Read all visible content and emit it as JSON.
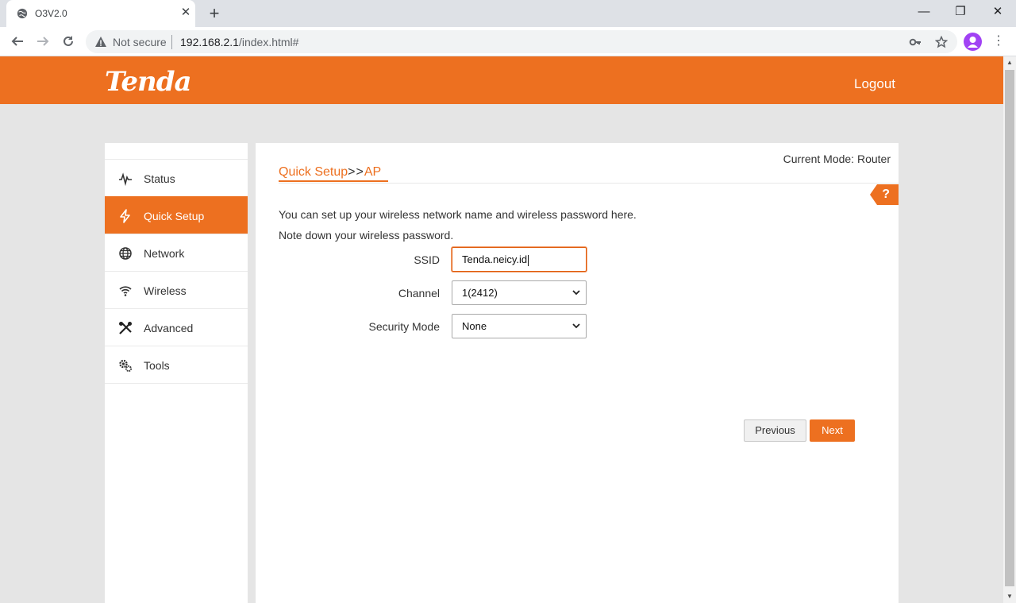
{
  "browser": {
    "tab_title": "O3V2.0",
    "tab_close": "✕",
    "new_tab": "+",
    "security_label": "Not secure",
    "url_host": "192.168.2.1",
    "url_path": "/index.html#",
    "window": {
      "minimize": "—",
      "restore": "❐",
      "close": "✕"
    }
  },
  "header": {
    "logo_text": "Tenda",
    "logout_label": "Logout"
  },
  "sidebar": {
    "items": [
      {
        "label": "Status",
        "icon": "pulse-icon"
      },
      {
        "label": "Quick Setup",
        "icon": "bolt-icon",
        "active": true
      },
      {
        "label": "Network",
        "icon": "globe-icon"
      },
      {
        "label": "Wireless",
        "icon": "wifi-icon"
      },
      {
        "label": "Advanced",
        "icon": "tools-icon"
      },
      {
        "label": "Tools",
        "icon": "gear-icon"
      }
    ]
  },
  "main": {
    "current_mode": "Current Mode: Router",
    "breadcrumb_section": "Quick Setup",
    "breadcrumb_sep": ">>",
    "breadcrumb_page": "AP",
    "help_label": "?",
    "description_1": "You can set up your wireless network name and wireless password here.",
    "description_2": "Note down your wireless password.",
    "form": {
      "ssid_label": "SSID",
      "ssid_value": "Tenda.neicy.id",
      "channel_label": "Channel",
      "channel_value": "1(2412)",
      "security_label": "Security Mode",
      "security_value": "None"
    },
    "previous_label": "Previous",
    "next_label": "Next"
  },
  "colors": {
    "brand": "#ed7020",
    "page_bg": "#e5e5e5"
  }
}
